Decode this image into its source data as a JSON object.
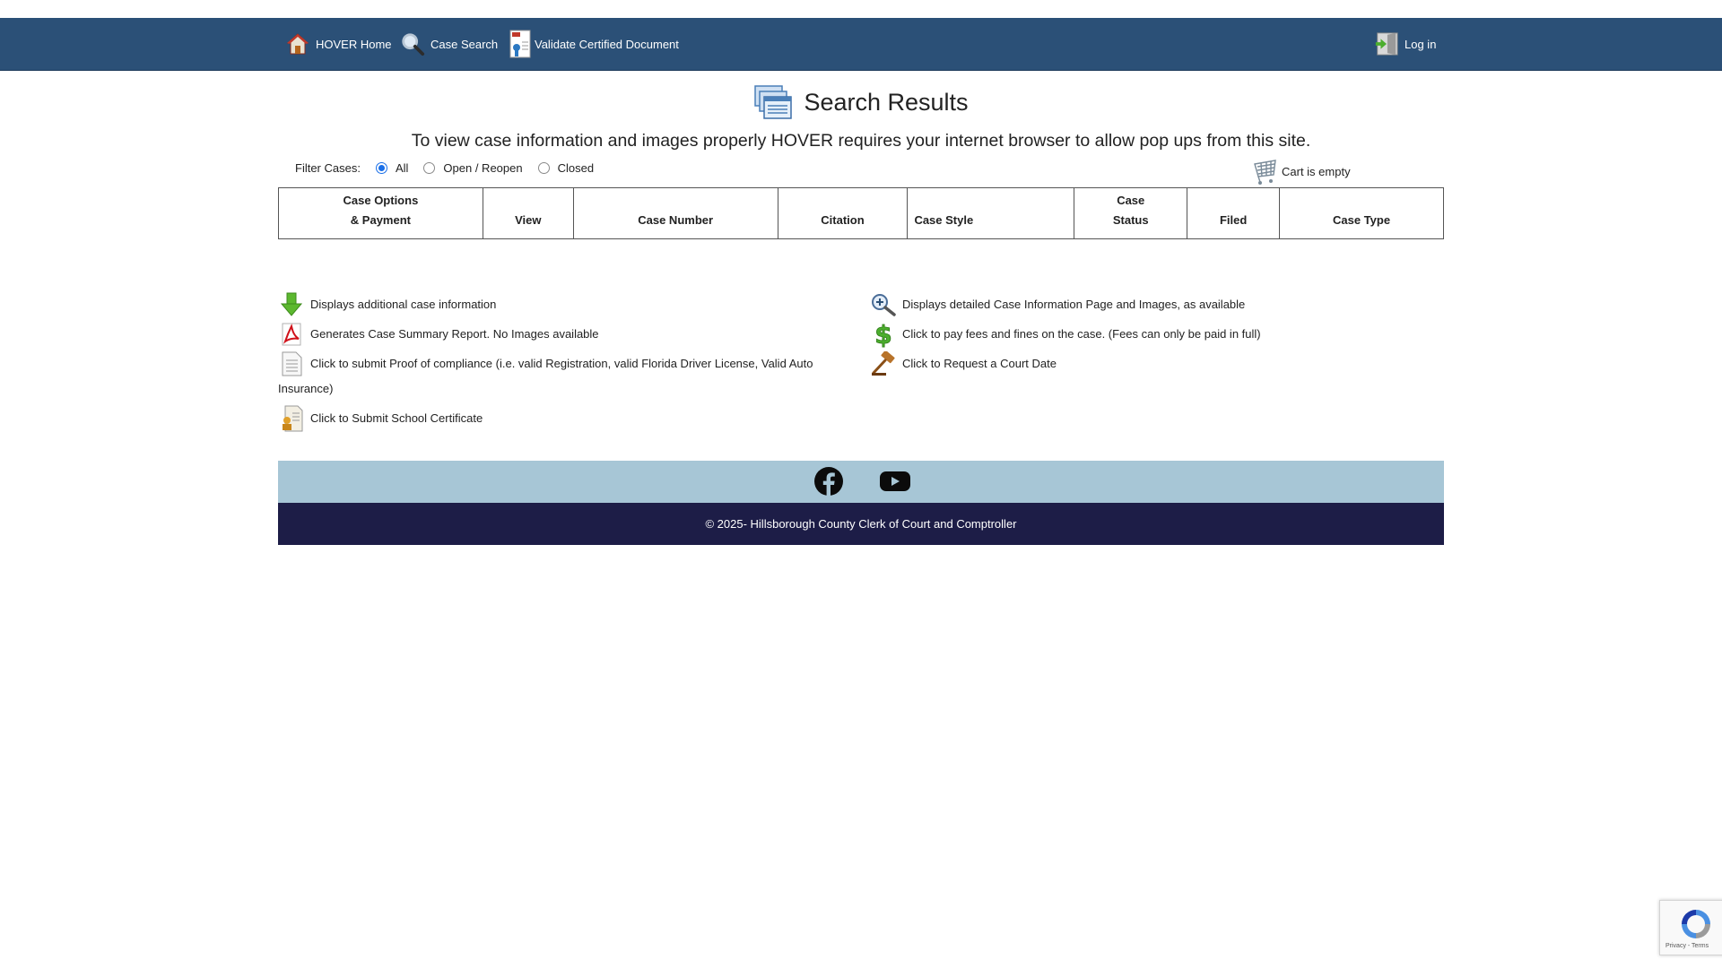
{
  "nav": {
    "home": "HOVER Home",
    "case_search": "Case Search",
    "validate": "Validate Certified Document",
    "login": "Log in"
  },
  "page": {
    "title": "Search Results",
    "popup_note": "To view case information and images properly HOVER requires your internet browser to allow pop ups from this site."
  },
  "filter": {
    "label": "Filter Cases:",
    "options": [
      "All",
      "Open / Reopen",
      "Closed"
    ],
    "selected": "All"
  },
  "cart": {
    "label": "Cart is empty"
  },
  "table": {
    "headers": [
      {
        "line1": "Case Options",
        "line2": "& Payment"
      },
      {
        "line1": "",
        "line2": "View"
      },
      {
        "line1": "",
        "line2": "Case Number"
      },
      {
        "line1": "",
        "line2": "Citation"
      },
      {
        "line1": "",
        "line2": "Case Style"
      },
      {
        "line1": "Case",
        "line2": "Status"
      },
      {
        "line1": "",
        "line2": "Filed"
      },
      {
        "line1": "",
        "line2": "Case Type"
      }
    ]
  },
  "legend": {
    "left": [
      {
        "icon": "green-down-arrow-icon",
        "text": "Displays additional case information"
      },
      {
        "icon": "pdf-icon",
        "text": "Generates Case Summary Report. No Images available"
      },
      {
        "icon": "document-icon",
        "text": "Click to submit Proof of compliance (i.e. valid Registration, valid Florida Driver License, Valid Auto Insurance)"
      },
      {
        "icon": "certificate-icon",
        "text": "Click to Submit School Certificate"
      }
    ],
    "right": [
      {
        "icon": "magnifier-plus-icon",
        "text": "Displays detailed Case Information Page and Images, as available"
      },
      {
        "icon": "dollar-icon",
        "text": "Click to pay fees and fines on the case. (Fees can only be paid in full)"
      },
      {
        "icon": "gavel-icon",
        "text": "Click to Request a Court Date"
      }
    ]
  },
  "footer": {
    "copyright": "© 2025- Hillsborough County Clerk of Court and Comptroller"
  },
  "recaptcha": {
    "text": "Privacy - Terms"
  },
  "colors": {
    "navbar": "#2b5077",
    "social_bar": "#a7c6d6",
    "footer": "#1d1d47",
    "radio_accent": "#1a6fe8"
  }
}
